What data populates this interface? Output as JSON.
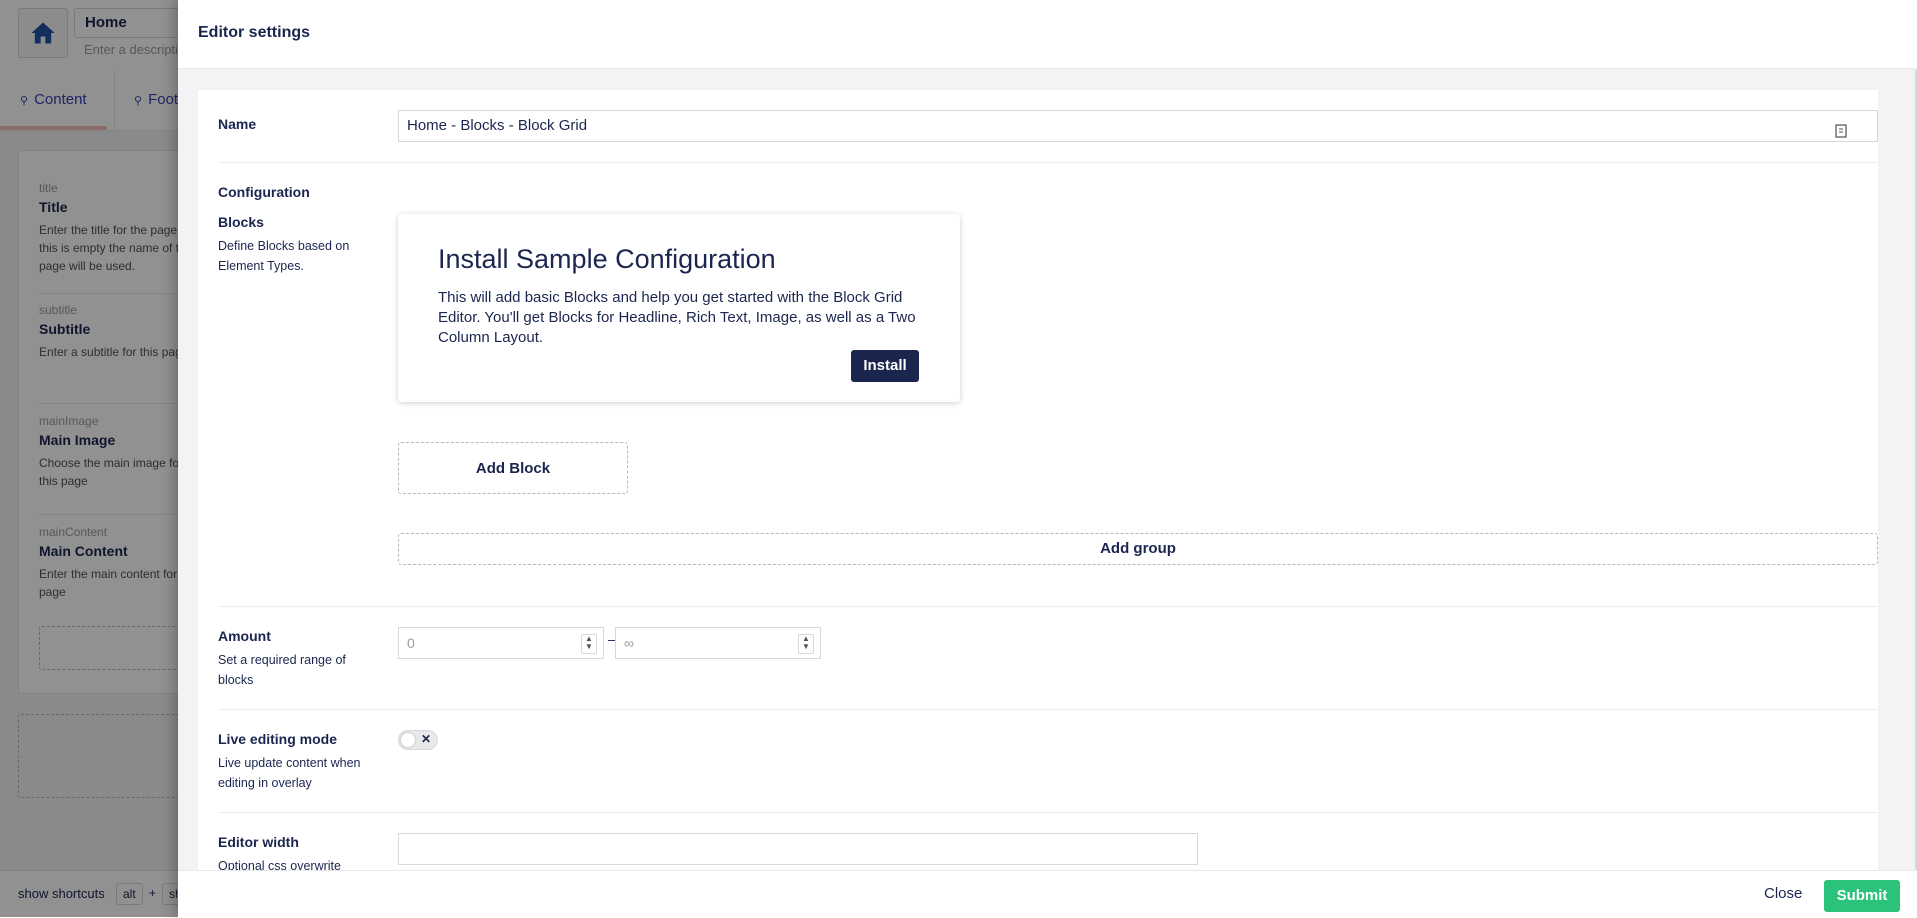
{
  "background": {
    "page_name": "Home",
    "description_placeholder": "Enter a descripti",
    "tabs": [
      {
        "label": "Content"
      },
      {
        "label": "Foot"
      }
    ],
    "properties": [
      {
        "alias": "title",
        "label": "Title",
        "desc": "Enter the title for the page this is empty the name of t page will be used."
      },
      {
        "alias": "subtitle",
        "label": "Subtitle",
        "desc": "Enter a subtitle for this pag"
      },
      {
        "alias": "mainImage",
        "label": "Main Image",
        "desc": "Choose the main image for this page"
      },
      {
        "alias": "mainContent",
        "label": "Main Content",
        "desc": "Enter the main content for the page"
      }
    ],
    "footer": {
      "shortcuts_label": "show shortcuts",
      "key1": "alt",
      "plus": "+",
      "key2": "sh"
    }
  },
  "panel": {
    "title": "Editor settings",
    "name": {
      "label": "Name",
      "value": "Home - Blocks - Block Grid"
    },
    "configuration": {
      "label": "Configuration"
    },
    "blocks": {
      "label": "Blocks",
      "desc": "Define Blocks based on Element Types."
    },
    "sample": {
      "title": "Install Sample Configuration",
      "text": "This will add basic Blocks and help you get started with the Block Grid Editor. You'll get Blocks for Headline, Rich Text, Image, as well as a Two Column Layout.",
      "install_label": "Install"
    },
    "add_block_label": "Add Block",
    "add_group_label": "Add group",
    "amount": {
      "label": "Amount",
      "desc": "Set a required range of blocks",
      "min_placeholder": "0",
      "max_placeholder": "∞",
      "separator": "–"
    },
    "live_editing": {
      "label": "Live editing mode",
      "desc": "Live update content when editing in overlay",
      "enabled": false,
      "toggle_mark": "✕"
    },
    "editor_width": {
      "label": "Editor width",
      "desc": "Optional css overwrite"
    },
    "close_label": "Close",
    "submit_label": "Submit"
  },
  "colors": {
    "primary": "#1b264f",
    "submit": "#2bc37c",
    "overlay": "rgba(0,0,0,0.43)"
  },
  "icons": [
    "home-icon",
    "document-icon",
    "copy-icon"
  ]
}
